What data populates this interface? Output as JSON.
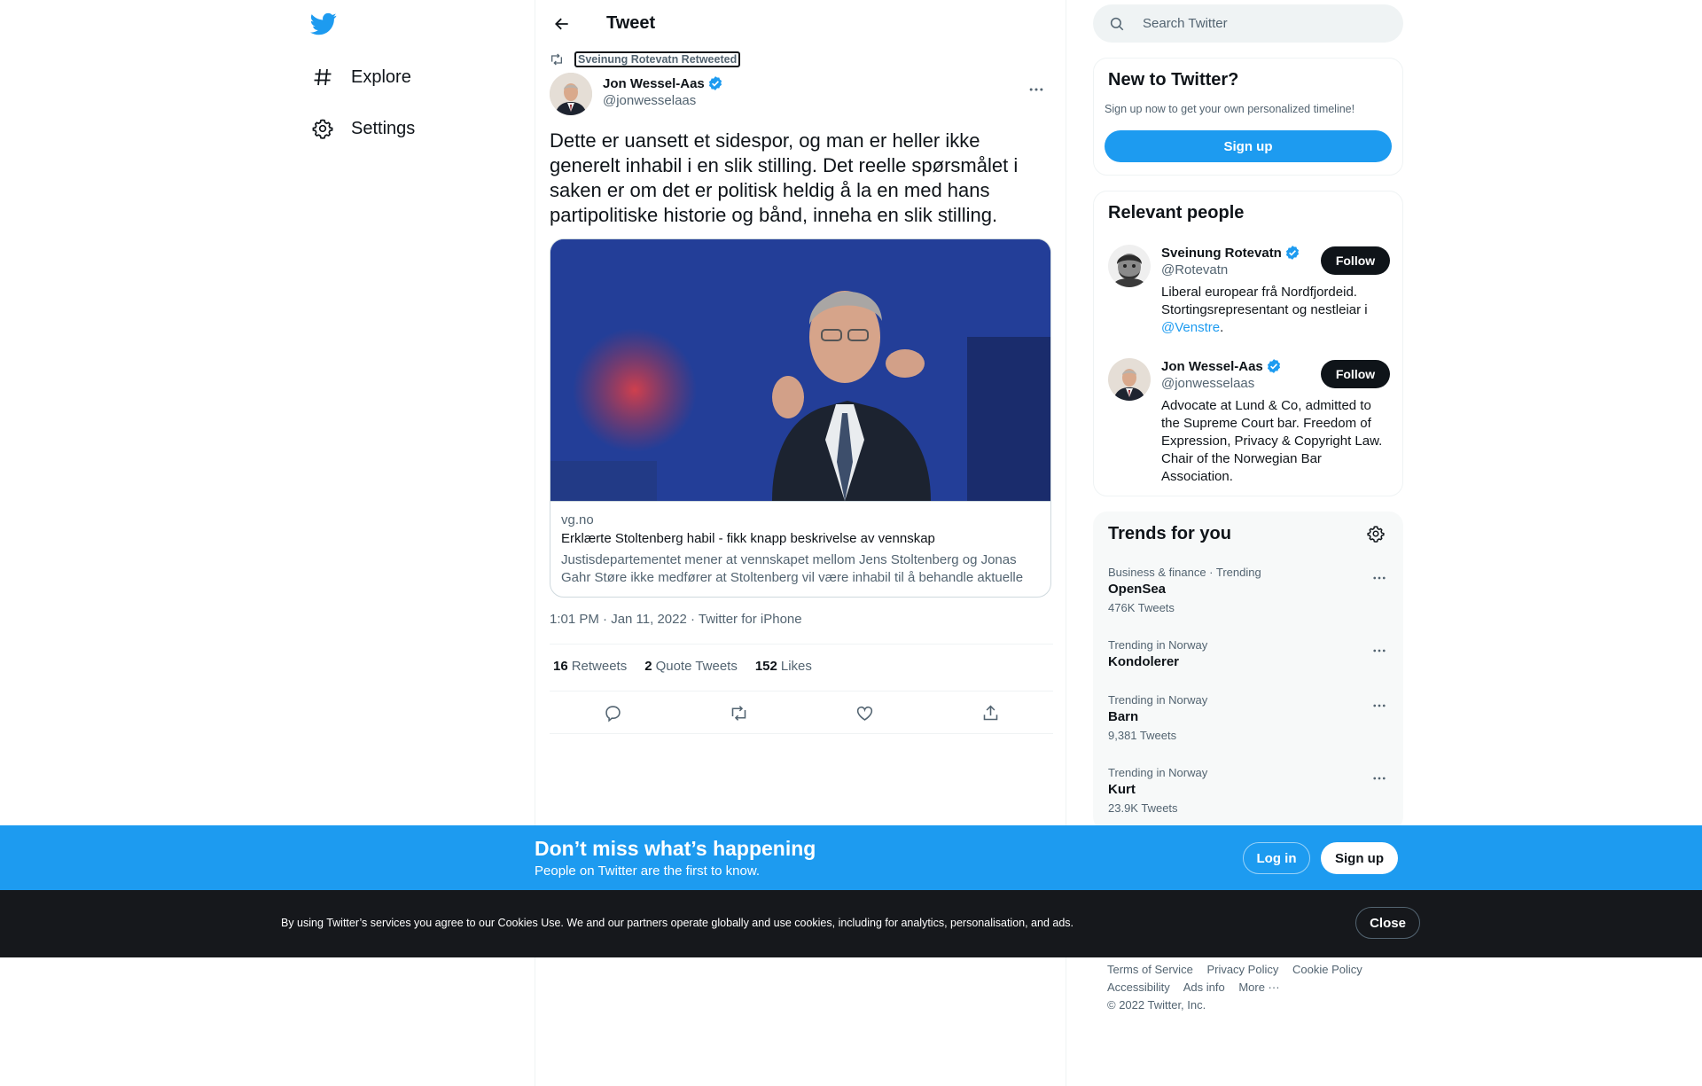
{
  "nav": {
    "items": [
      {
        "label": "Explore",
        "icon": "hashtag-icon"
      },
      {
        "label": "Settings",
        "icon": "gear-icon"
      }
    ]
  },
  "header": {
    "title": "Tweet"
  },
  "tweet": {
    "retweeted_by": "Sveinung Rotevatn Retweeted",
    "author_name": "Jon Wessel-Aas",
    "author_handle": "@jonwesselaas",
    "text": "Dette er uansett et sidespor, og man er heller ikke generelt inhabil i en slik stilling. Det reelle spørsmålet i saken er om det er politisk heldig å la en med hans partipolitiske historie og bånd, inneha en slik stilling.",
    "card": {
      "domain": "vg.no",
      "title": "Erklærte Stoltenberg habil - fikk knapp beskrivelse av vennskap",
      "description": "Justisdepartementet mener at vennskapet mellom Jens Stoltenberg og Jonas Gahr Støre ikke medfører at Stoltenberg vil være inhabil til å behandle aktuelle saker..."
    },
    "meta": "1:01 PM · Jan 11, 2022 · Twitter for iPhone",
    "stats": {
      "retweets": "16",
      "retweets_label": "Retweets",
      "quotes": "2",
      "quotes_label": "Quote Tweets",
      "likes": "152",
      "likes_label": "Likes"
    }
  },
  "search": {
    "placeholder": "Search Twitter"
  },
  "new_to_twitter": {
    "title": "New to Twitter?",
    "subtitle": "Sign up now to get your own personalized timeline!",
    "button": "Sign up"
  },
  "relevant_people": {
    "title": "Relevant people",
    "people": [
      {
        "name": "Sveinung Rotevatn",
        "handle": "@Rotevatn",
        "bio_text": "Liberal europear frå Nordfjordeid. Stortingsrepresentant og nestleiar i ",
        "bio_link": "@Venstre",
        "bio_end": ".",
        "button": "Follow"
      },
      {
        "name": "Jon Wessel-Aas",
        "handle": "@jonwesselaas",
        "bio_text": "Advocate at Lund & Co, admitted to the Supreme Court bar. Freedom of Expression, Privacy & Copyright Law. Chair of the Norwegian Bar Association.",
        "button": "Follow"
      }
    ]
  },
  "trends": {
    "title": "Trends for you",
    "items": [
      {
        "context": "Business & finance · Trending",
        "name": "OpenSea",
        "count": "476K Tweets"
      },
      {
        "context": "Trending in Norway",
        "name": "Kondolerer",
        "count": ""
      },
      {
        "context": "Trending in Norway",
        "name": "Barn",
        "count": "9,381 Tweets"
      },
      {
        "context": "Trending in Norway",
        "name": "Kurt",
        "count": "23.9K Tweets"
      }
    ]
  },
  "footer": {
    "links_row1": [
      "Terms of Service",
      "Privacy Policy",
      "Cookie Policy"
    ],
    "links_row2": [
      "Accessibility",
      "Ads info",
      "More ···"
    ],
    "copyright": "© 2022 Twitter, Inc."
  },
  "banner": {
    "title": "Don’t miss what’s happening",
    "subtitle": "People on Twitter are the first to know.",
    "login": "Log in",
    "signup": "Sign up"
  },
  "cookie": {
    "text": "By using Twitter’s services you agree to our Cookies Use. We and our partners operate globally and use cookies, including for analytics, personalisation, and ads.",
    "close": "Close"
  },
  "colors": {
    "accent": "#1d9bf0",
    "text": "#0f1419",
    "secondary": "#536471",
    "cookie_bg": "#16181c"
  }
}
